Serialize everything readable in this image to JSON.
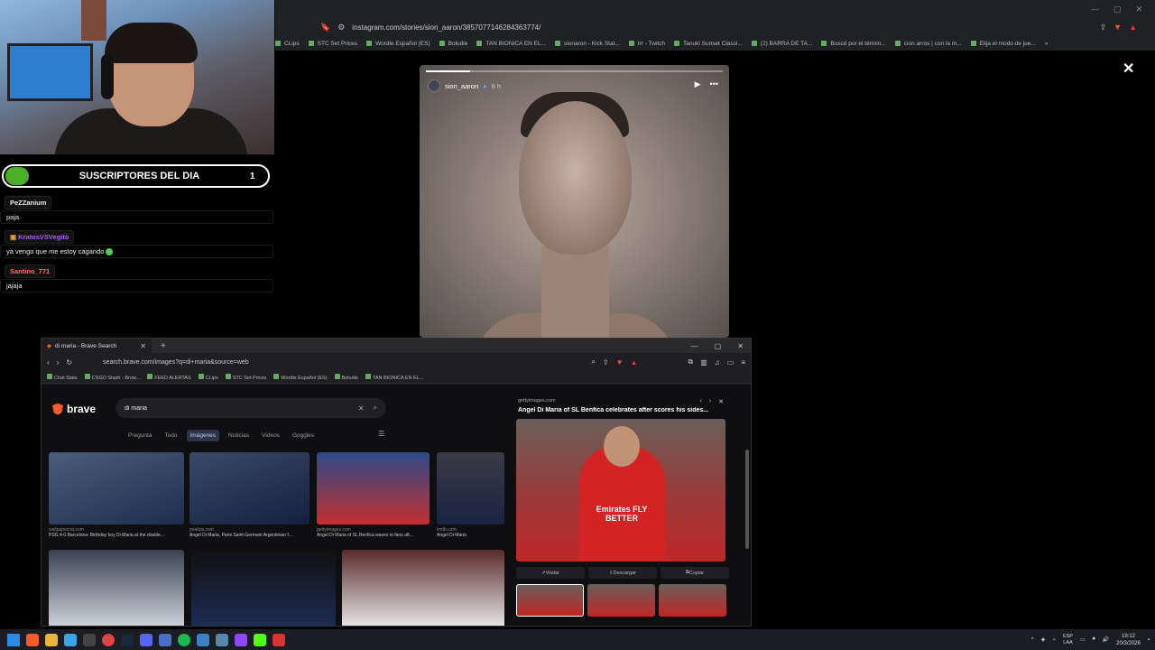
{
  "back_browser": {
    "url": "instagram.com/stories/sion_aaron/3857077146284363774/",
    "bookmarks": [
      "CLips",
      "STC Set Prices",
      "Wordle Español (ES)",
      "Boludle",
      "TAN BIONICA EN EL...",
      "sionaron - Kick Stat...",
      "trr - Twitch",
      "Tanuki Sunset Classi...",
      "(2) BARRA DE TA...",
      "Buscó por el términ...",
      "cion arros | con la m...",
      "Elija el modo de jue..."
    ],
    "more": "»"
  },
  "story": {
    "username": "sion_aaron",
    "time": "6 h",
    "progress": 0.15,
    "close": "✕"
  },
  "stream": {
    "subs_label": "SUSCRIPTORES DEL DIA",
    "subs_count": "1",
    "chat": [
      {
        "user": "PeZZanium",
        "color": "#e8e8e8",
        "text": "paja"
      },
      {
        "user": "KratosVSVegito",
        "color": "#b35cff",
        "text": "ya vengo que me estoy cagando"
      },
      {
        "user": "Santino_771",
        "color": "#ff6b6b",
        "text": "jajaja"
      }
    ]
  },
  "front_browser": {
    "tab_title": "di maria - Brave Search",
    "url": "search.brave.com/images?q=di+maria&source=web",
    "bookmarks": [
      "Chat Stats",
      "CSGO Stash - Brow...",
      "FEED ALERTAS",
      "CLips",
      "STC Set Prices",
      "Wordle Español (ES)",
      "Boludle",
      "TAN BIONICA EN EL..."
    ],
    "brand": "brave",
    "query": "di maria",
    "filters": [
      "Pregunta",
      "Todo",
      "Imágenes",
      "Noticias",
      "Videos",
      "Goggles"
    ],
    "active_filter": "Imágenes",
    "results": [
      {
        "source": "wallpapercat.com",
        "caption": "PSG 4-0 Barcelona: Birthday boy Di Maria at the double..."
      },
      {
        "source": "peakpx.com",
        "caption": "Angel Di Maria, Paris Saint-Germain Argentinian f..."
      },
      {
        "source": "gettyimages.com",
        "caption": "Angel Di Maria of SL Benfica waves to fans aft..."
      },
      {
        "source": "imdb.com",
        "caption": "Angel Di Maria"
      }
    ],
    "detail": {
      "source": "gettyimages.com",
      "title": "Angel Di Maria of SL Benfica celebrates after scores his sides...",
      "sponsor": "Emirates FLY BETTER",
      "actions": [
        "Visitar",
        "Descargar",
        "Copiar"
      ]
    }
  },
  "taskbar": {
    "lang": "ESP",
    "lang_sub": "LAA",
    "time": "19:12",
    "date": "20/3/2026"
  }
}
